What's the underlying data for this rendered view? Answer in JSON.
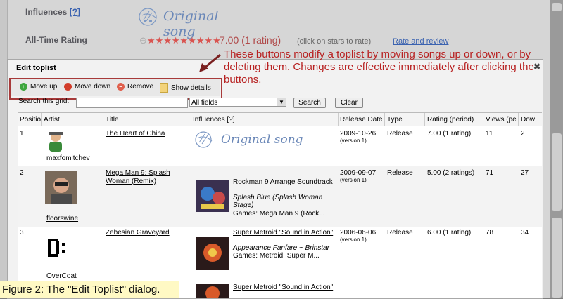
{
  "background": {
    "influences_label": "Influences",
    "influences_help": "[?]",
    "original_song": "Original song",
    "alltime_label": "All-Time Rating",
    "rating_value": "7.00 (1 rating)",
    "rating_hint": "(click on stars to rate)",
    "rate_link": "Rate and review"
  },
  "annotation": "These buttons modify a toplist by moving songs up or down, or by deleting them.  Changes are effective immediately after clicking the buttons.",
  "dialog": {
    "title": "Edit toplist",
    "close": "✖",
    "toolbar": {
      "move_up": "Move up",
      "move_down": "Move down",
      "remove": "Remove",
      "show_details": "Show details"
    },
    "search": {
      "label": "Search this grid:",
      "value": "",
      "field_select": "All fields",
      "search_button": "Search",
      "clear_button": "Clear"
    },
    "columns": [
      "Positio",
      "Artist",
      "Title",
      "Influences [?]",
      "Release Date",
      "Type",
      "Rating (period)",
      "Views (pe",
      "Dow"
    ],
    "rows": [
      {
        "position": "1",
        "artist": "maxfomitchev",
        "title": "The Heart of China",
        "influence": "Original song",
        "release_date": "2009-10-26",
        "version": "(version 1)",
        "type": "Release",
        "rating": "7.00 (1 rating)",
        "views": "11",
        "downloads": "2"
      },
      {
        "position": "2",
        "artist": "floorswine",
        "title": "Mega Man 9: Splash Woman (Remix)",
        "influence_title": "Rockman 9 Arrange Soundtrack",
        "influence_track": "Splash Blue (Splash Woman Stage)",
        "influence_games": "Games: Mega Man 9 (Rock...",
        "release_date": "2009-09-07",
        "version": "(version 1)",
        "type": "Release",
        "rating": "5.00 (2 ratings)",
        "views": "71",
        "downloads": "27"
      },
      {
        "position": "3",
        "artist": "OverCoat",
        "title": "Zebesian Graveyard",
        "influence_title": "Super Metroid \"Sound in Action\"",
        "influence_track": "Appearance Fanfare ~ Brinstar",
        "influence_games": "Games: Metroid, Super M...",
        "influence2_title": "Super Metroid \"Sound in Action\"",
        "release_date": "2006-06-06",
        "version": "(version 1)",
        "type": "Release",
        "rating": "6.00 (1 rating)",
        "views": "78",
        "downloads": "34"
      }
    ]
  },
  "caption": "Figure 2:  The \"Edit Toplist\" dialog.",
  "colors": {
    "annotation_red": "#b82222",
    "link_blue": "#3a62b0",
    "caption_bg": "#fff9c4"
  }
}
